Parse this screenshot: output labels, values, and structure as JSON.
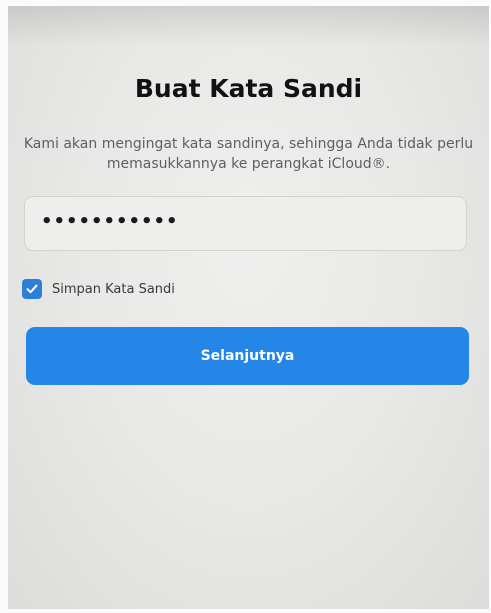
{
  "header": {
    "title": "Buat Kata Sandi"
  },
  "description": "Kami akan mengingat kata sandinya, sehingga Anda tidak perlu memasukkannya ke perangkat iCloud®.",
  "password_field": {
    "value": "•••••••••••"
  },
  "save_password": {
    "label": "Simpan Kata Sandi",
    "checked": true
  },
  "next_button": {
    "label": "Selanjutnya"
  },
  "colors": {
    "accent": "#2486e6",
    "checkbox": "#2c80d8",
    "title": "#121212",
    "body_text": "#5f5f63"
  }
}
